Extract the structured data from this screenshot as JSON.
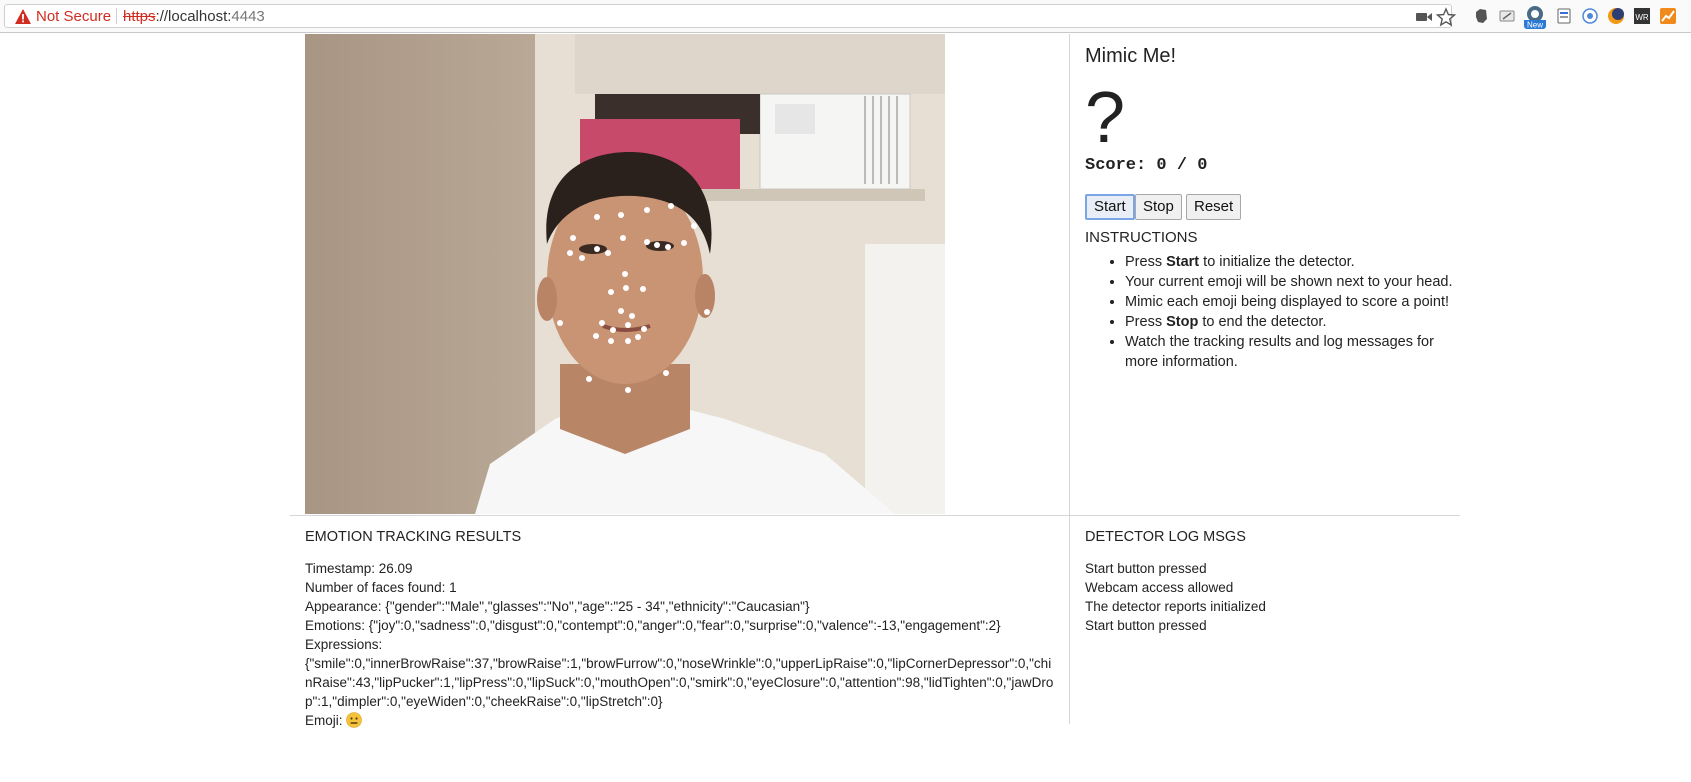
{
  "browser": {
    "security_label": "Not Secure",
    "url_scheme": "https",
    "url_host": "://localhost:",
    "url_port": "4443",
    "icons": [
      "camera-icon",
      "star-icon",
      "evernote-icon",
      "pencil-icon",
      "new-extension-icon",
      "bookmark-extension-icon",
      "globe-extension-icon",
      "moon-extension-icon",
      "wr-extension-icon",
      "chart-extension-icon"
    ],
    "new_badge": "New",
    "wr_label": "WR"
  },
  "app": {
    "title": "Mimic Me!",
    "target_emoji": "?",
    "score_label": "Score:",
    "score_value": "0 / 0",
    "buttons": {
      "start": "Start",
      "stop": "Stop",
      "reset": "Reset"
    },
    "instructions_heading": "INSTRUCTIONS",
    "instructions": [
      {
        "pre": "Press ",
        "bold": "Start",
        "post": " to initialize the detector."
      },
      {
        "pre": "Your current emoji will be shown next to your head.",
        "bold": "",
        "post": ""
      },
      {
        "pre": "Mimic each emoji being displayed to score a point!",
        "bold": "",
        "post": ""
      },
      {
        "pre": "Press ",
        "bold": "Stop",
        "post": " to end the detector."
      },
      {
        "pre": "Watch the tracking results and log messages for more information.",
        "bold": "",
        "post": ""
      }
    ]
  },
  "results": {
    "heading": "EMOTION TRACKING RESULTS",
    "timestamp": "Timestamp: 26.09",
    "faces": "Number of faces found: 1",
    "appearance": "Appearance: {\"gender\":\"Male\",\"glasses\":\"No\",\"age\":\"25 - 34\",\"ethnicity\":\"Caucasian\"}",
    "emotions": "Emotions: {\"joy\":0,\"sadness\":0,\"disgust\":0,\"contempt\":0,\"anger\":0,\"fear\":0,\"surprise\":0,\"valence\":-13,\"engagement\":2}",
    "expressions_label": "Expressions:",
    "expressions": "{\"smile\":0,\"innerBrowRaise\":37,\"browRaise\":1,\"browFurrow\":0,\"noseWrinkle\":0,\"upperLipRaise\":0,\"lipCornerDepressor\":0,\"chinRaise\":43,\"lipPucker\":1,\"lipPress\":0,\"lipSuck\":0,\"mouthOpen\":0,\"smirk\":0,\"eyeClosure\":0,\"attention\":98,\"lidTighten\":0,\"jawDrop\":1,\"dimpler\":0,\"eyeWiden\":0,\"cheekRaise\":0,\"lipStretch\":0}",
    "emoji_label": "Emoji:",
    "emoji_icon": "neutral-face-emoji"
  },
  "log": {
    "heading": "DETECTOR LOG MSGS",
    "messages": [
      "Start button pressed",
      "Webcam access allowed",
      "The detector reports initialized",
      "Start button pressed"
    ]
  },
  "webcam": {
    "image": "webcam frame: man in white t-shirt with facial landmark dots"
  },
  "colors": {
    "insecure": "#d12c21",
    "focus_ring": "#7aa6e6",
    "divider": "#d6d6d6"
  }
}
